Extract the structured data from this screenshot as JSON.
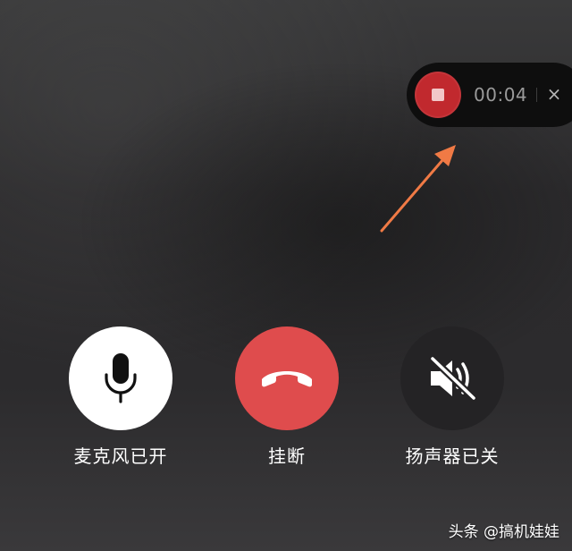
{
  "recording": {
    "timer": "00:04",
    "close_symbol": "×",
    "stop_icon": "stop-icon",
    "accent": "#c1292e"
  },
  "annotation": {
    "arrow_color": "#f07a45"
  },
  "controls": {
    "mic": {
      "label": "麦克风已开",
      "icon": "microphone-icon",
      "bg": "#ffffff"
    },
    "hangup": {
      "label": "挂断",
      "icon": "phone-hangup-icon",
      "bg": "#df4c4d"
    },
    "speaker": {
      "label": "扬声器已关",
      "icon": "speaker-muted-icon",
      "bg": "#242325"
    }
  },
  "watermark": {
    "text": "头条 @搞机娃娃"
  }
}
